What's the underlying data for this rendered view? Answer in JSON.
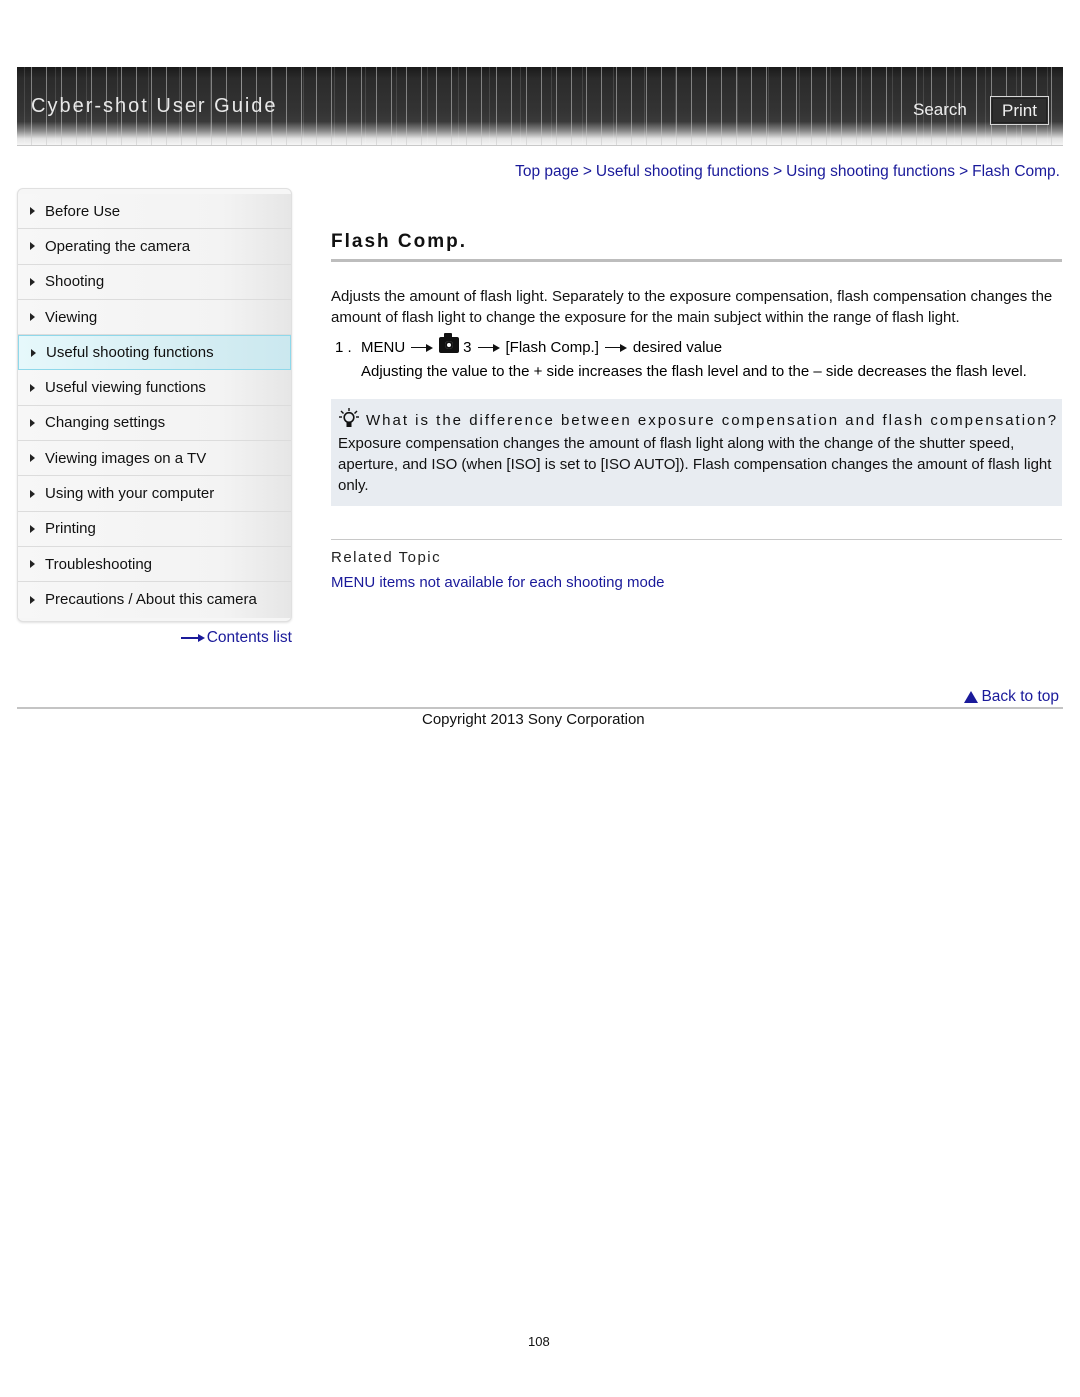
{
  "header": {
    "title": "Cyber-shot User Guide",
    "search_label": "Search",
    "print_label": "Print"
  },
  "breadcrumb": {
    "items": [
      "Top page",
      "Useful shooting functions",
      "Using shooting functions",
      "Flash Comp."
    ],
    "separator": ">"
  },
  "sidebar": {
    "items": [
      {
        "label": "Before Use"
      },
      {
        "label": "Operating the camera"
      },
      {
        "label": "Shooting"
      },
      {
        "label": "Viewing"
      },
      {
        "label": "Useful shooting functions",
        "active": true
      },
      {
        "label": "Useful viewing functions"
      },
      {
        "label": "Changing settings"
      },
      {
        "label": "Viewing images on a TV"
      },
      {
        "label": "Using with your computer"
      },
      {
        "label": "Printing"
      },
      {
        "label": "Troubleshooting"
      },
      {
        "label": "Precautions / About this camera"
      }
    ],
    "contents_list_label": "Contents list"
  },
  "main": {
    "title": "Flash Comp.",
    "intro": "Adjusts the amount of flash light. Separately to the exposure compensation, flash compensation changes the amount of flash light to change the exposure for the main subject within the range of flash light.",
    "steps": [
      {
        "number": "1 .",
        "menu": "MENU",
        "icon": "camera-icon",
        "tab_number": "3",
        "item": "[Flash Comp.]",
        "value": "desired value",
        "description": "Adjusting the value to the + side increases the flash level and to the – side decreases the flash level."
      }
    ],
    "hint": {
      "icon": "lightbulb-icon",
      "title": "What is the difference between exposure compensation and flash compensation?",
      "body": "Exposure compensation changes the amount of flash light along with the change of the shutter speed, aperture, and ISO (when [ISO] is set to [ISO AUTO]). Flash compensation changes the amount of flash light only."
    },
    "related": {
      "title": "Related Topic",
      "links": [
        "MENU items not available for each shooting mode"
      ]
    }
  },
  "footer": {
    "back_to_top": "Back to top",
    "copyright": "Copyright 2013 Sony Corporation",
    "page_number": "108"
  },
  "colors": {
    "link": "#1a1a9a",
    "header_bg": "#333333",
    "hint_bg": "#e8ecf1",
    "active_nav_border": "#8fd8ea"
  }
}
